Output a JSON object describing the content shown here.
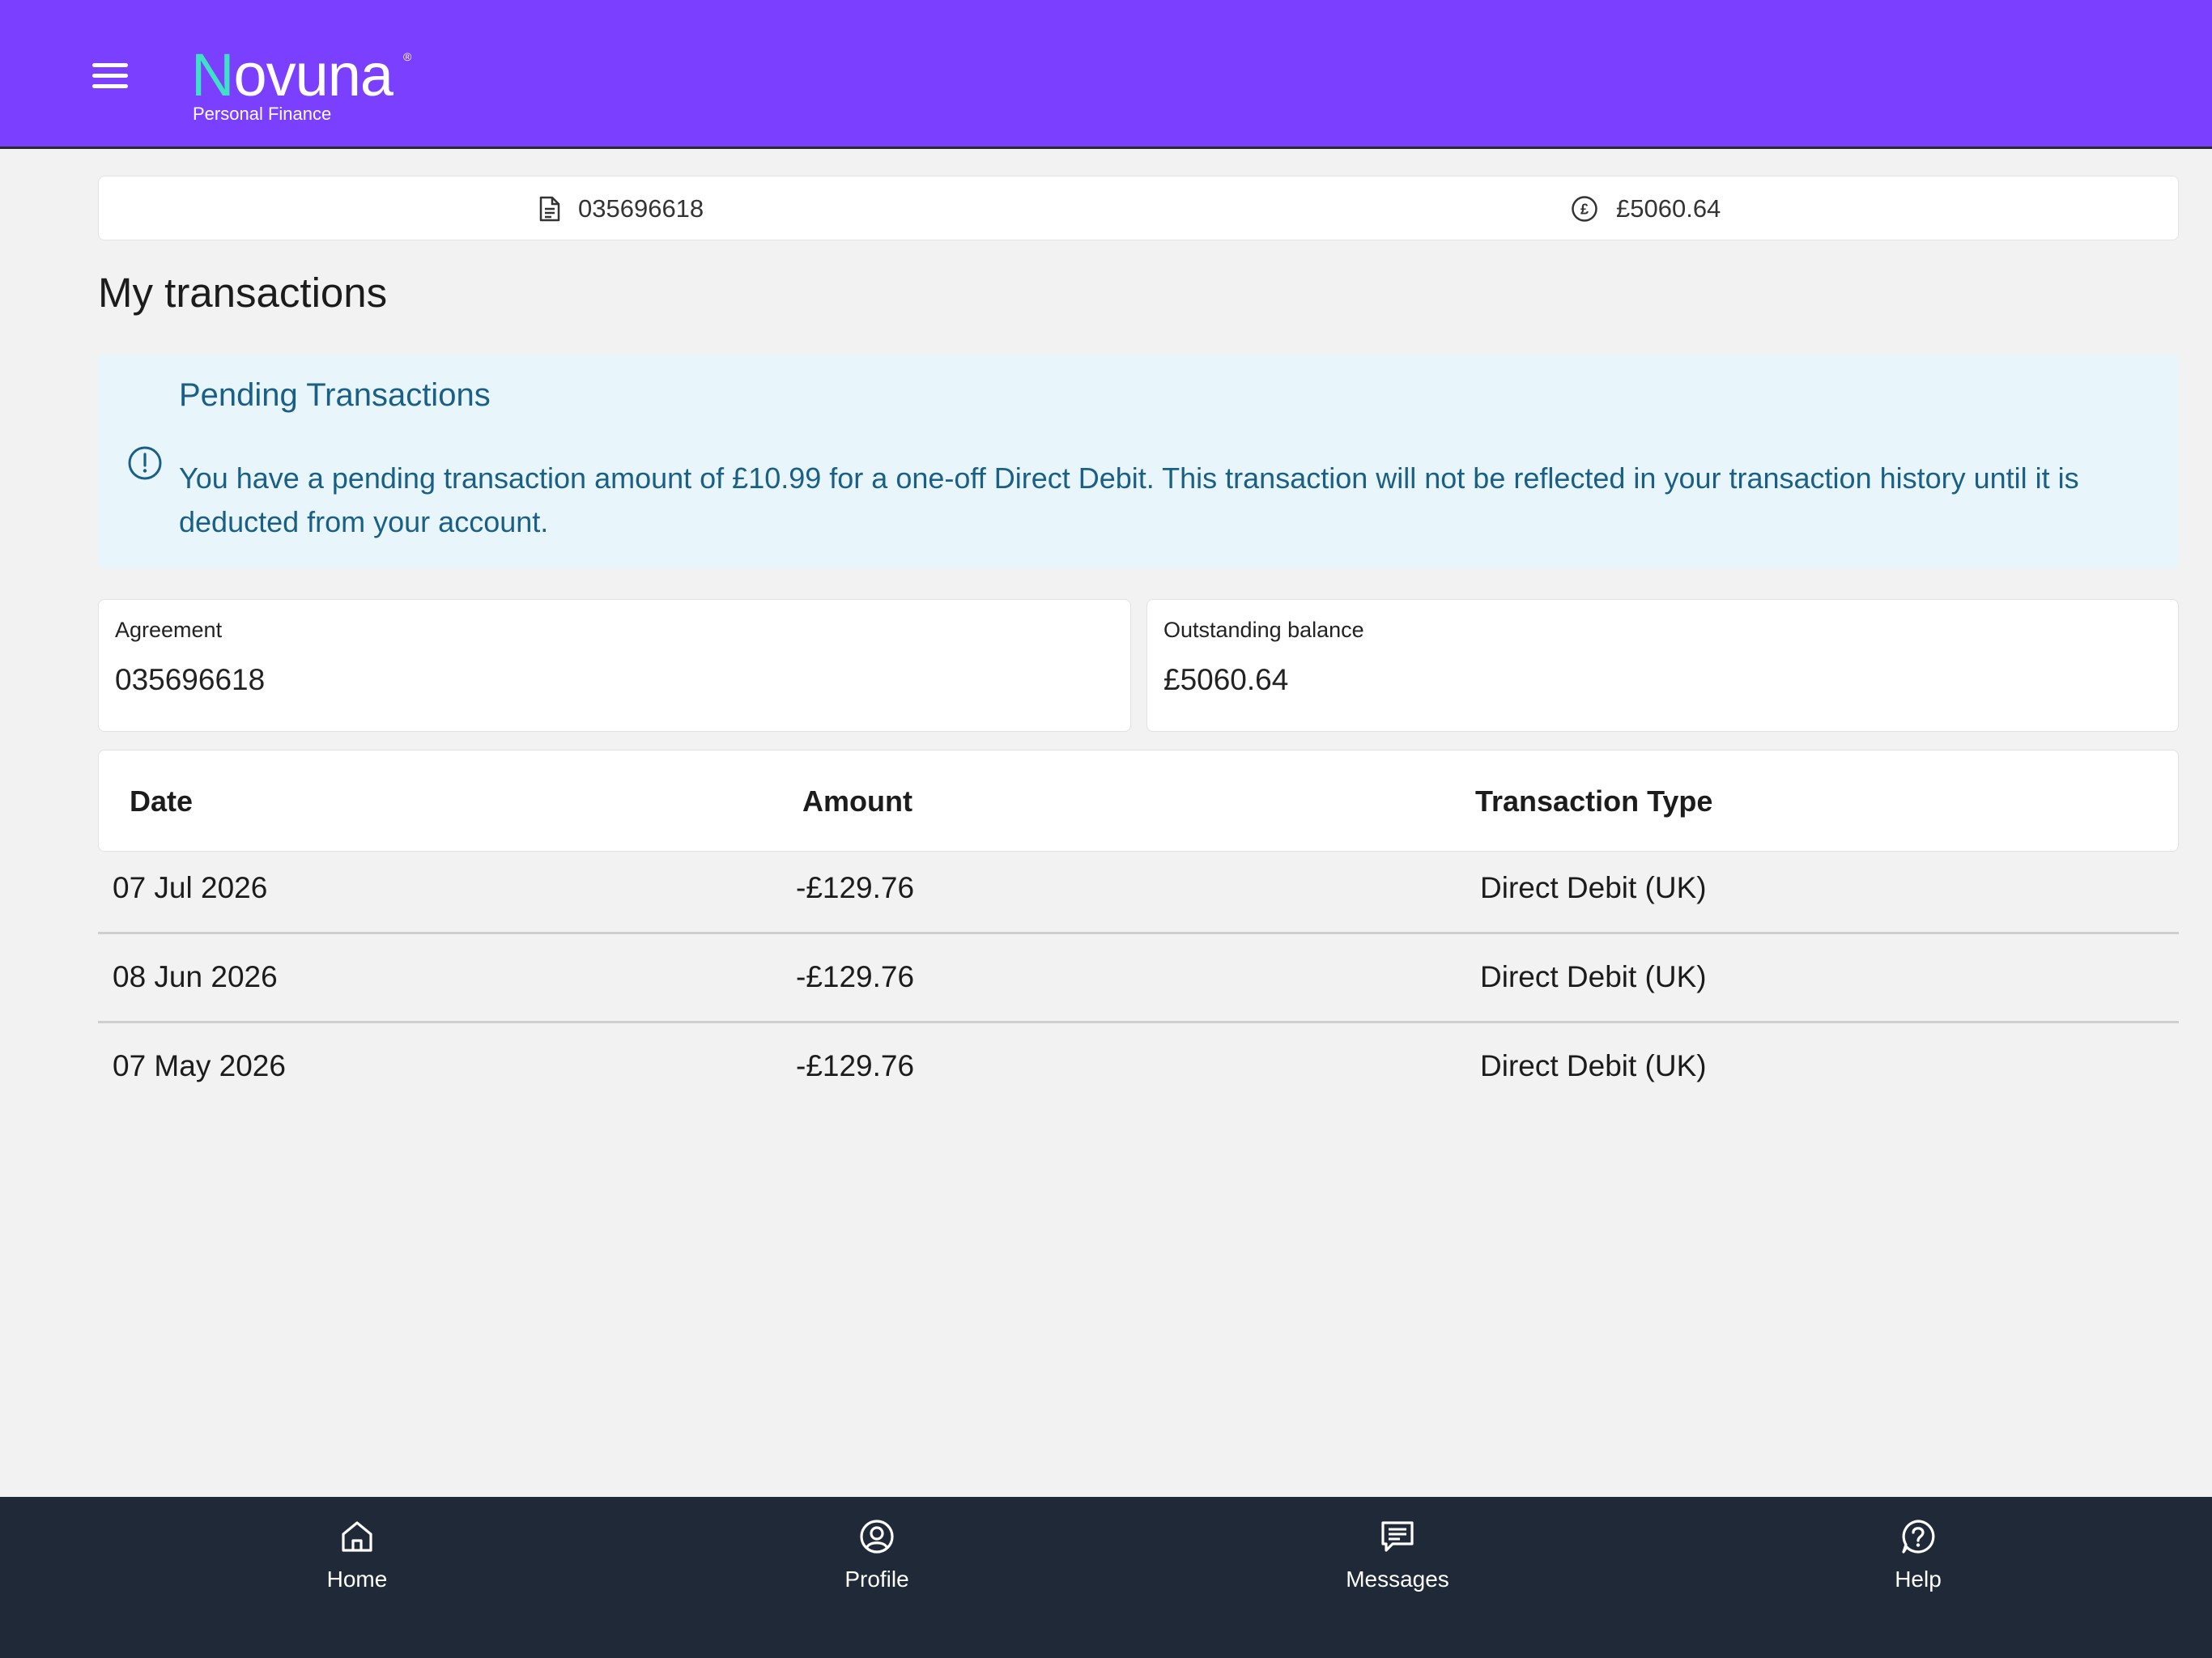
{
  "header": {
    "brand_name": "Novuna",
    "brand_subtitle": "Personal Finance",
    "brand_color": "#7b3fff"
  },
  "summary": {
    "agreement_number": "035696618",
    "balance": "£5060.64"
  },
  "page": {
    "title": "My transactions"
  },
  "alert": {
    "title": "Pending Transactions",
    "message": "You have a pending transaction amount of £10.99 for a one-off Direct Debit. This transaction will not be reflected in your transaction history until it is deducted from your account."
  },
  "cards": {
    "agreement": {
      "label": "Agreement",
      "value": "035696618"
    },
    "balance": {
      "label": "Outstanding balance",
      "value": "£5060.64"
    }
  },
  "table": {
    "headers": {
      "date": "Date",
      "amount": "Amount",
      "type": "Transaction Type"
    },
    "rows": [
      {
        "date": "07 Jul 2026",
        "amount": "-£129.76",
        "type": "Direct Debit (UK)"
      },
      {
        "date": "08 Jun 2026",
        "amount": "-£129.76",
        "type": "Direct Debit (UK)"
      },
      {
        "date": "07 May 2026",
        "amount": "-£129.76",
        "type": "Direct Debit (UK)"
      }
    ]
  },
  "bottom_nav": [
    {
      "label": "Home",
      "icon": "home-icon"
    },
    {
      "label": "Profile",
      "icon": "profile-icon"
    },
    {
      "label": "Messages",
      "icon": "messages-icon"
    },
    {
      "label": "Help",
      "icon": "help-icon"
    }
  ]
}
